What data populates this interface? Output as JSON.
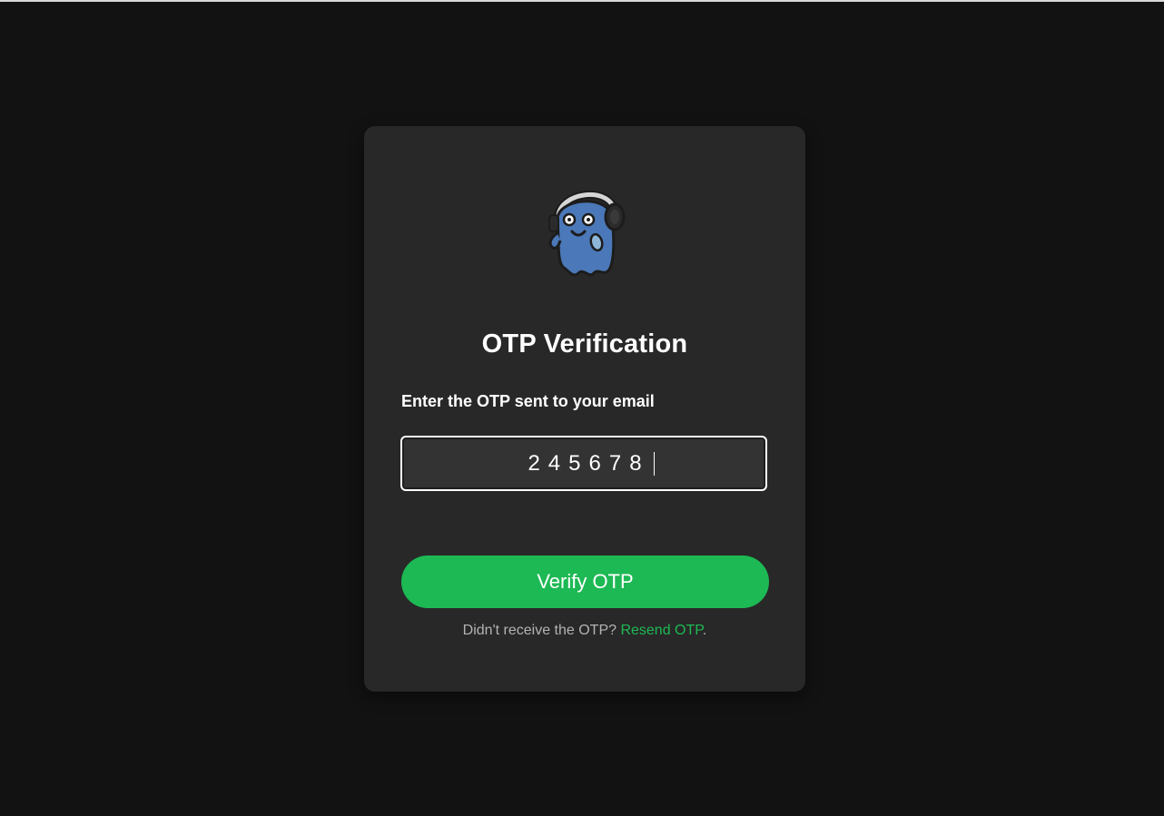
{
  "page": {
    "title": "OTP Verification",
    "otp_label": "Enter the OTP sent to your email",
    "otp_value": "245678",
    "verify_label": "Verify OTP",
    "resend_prompt": "Didn't receive the OTP? ",
    "resend_link": "Resend OTP",
    "resend_suffix": "."
  },
  "icons": {
    "mascot": "ghost-with-headphones-icon"
  },
  "colors": {
    "background": "#121212",
    "card": "#282828",
    "accent": "#1db954",
    "input_bg": "#333333",
    "mascot_body": "#4a78b8"
  }
}
